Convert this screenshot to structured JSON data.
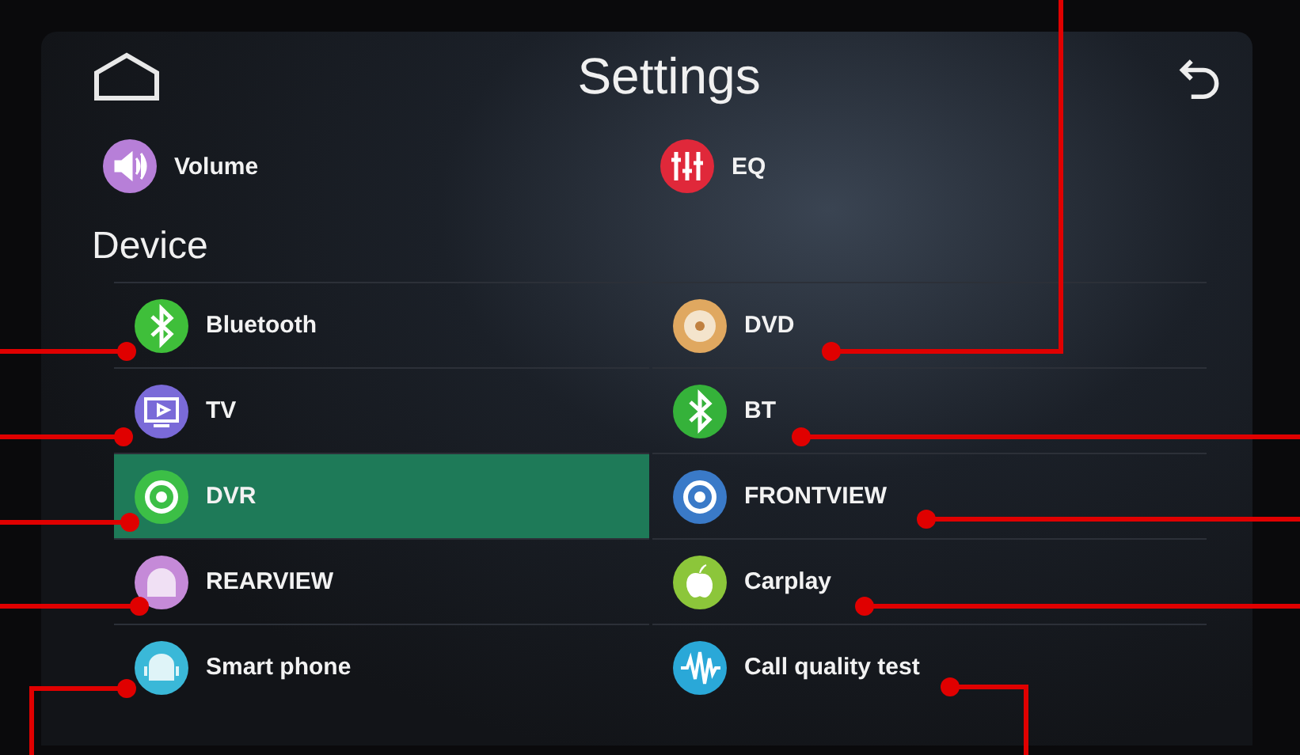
{
  "header": {
    "title": "Settings"
  },
  "top_items": [
    {
      "label": "Volume",
      "color": "#b77fd8"
    },
    {
      "label": "EQ",
      "color": "#e0283a"
    }
  ],
  "section": {
    "title": "Device"
  },
  "device_items": [
    {
      "label": "Bluetooth",
      "color": "#3fbf3a",
      "selected": false
    },
    {
      "label": "DVD",
      "color": "#e0a860",
      "selected": false
    },
    {
      "label": "TV",
      "color": "#7a6ad8",
      "selected": false
    },
    {
      "label": "BT",
      "color": "#35b23a",
      "selected": false
    },
    {
      "label": "DVR",
      "color": "#3cbf46",
      "selected": true
    },
    {
      "label": "FRONTVIEW",
      "color": "#3a7ac8",
      "selected": false
    },
    {
      "label": "REARVIEW",
      "color": "#c58ad8",
      "selected": false
    },
    {
      "label": "Carplay",
      "color": "#8cc63a",
      "selected": false
    },
    {
      "label": "Smart phone",
      "color": "#3ab8d8",
      "selected": false
    },
    {
      "label": "Call quality test",
      "color": "#2aa8d8",
      "selected": false
    }
  ]
}
